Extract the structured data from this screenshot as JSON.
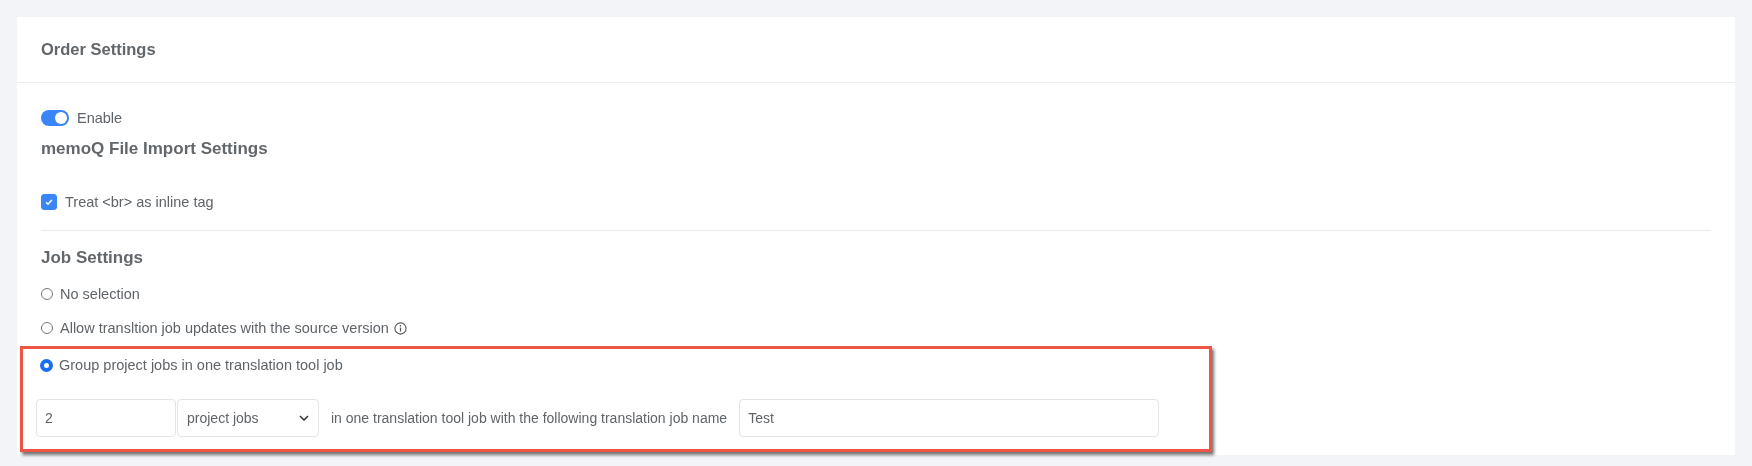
{
  "card": {
    "title": "Order Settings"
  },
  "enable_toggle": {
    "label": "Enable",
    "on": true
  },
  "import_settings": {
    "heading": "memoQ File Import Settings",
    "options": [
      {
        "label": "Treat <br> as inline tag",
        "checked": true
      }
    ]
  },
  "job_settings": {
    "heading": "Job Settings",
    "options": [
      {
        "label": "No selection",
        "selected": false,
        "info": false,
        "highlighted": false
      },
      {
        "label": "Allow transltion job updates with the source version",
        "selected": false,
        "info": true,
        "highlighted": false
      },
      {
        "label": "Group project jobs in one translation tool job",
        "selected": true,
        "info": false,
        "highlighted": true
      }
    ],
    "group_row": {
      "count_value": "2",
      "unit_select": "project jobs",
      "middle_text": "in one translation tool job with the following translation job name",
      "job_name_value": "Test"
    }
  }
}
